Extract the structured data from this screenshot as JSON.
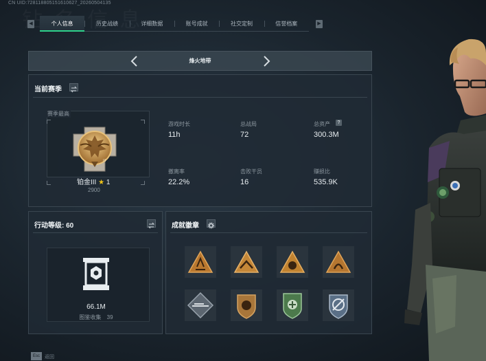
{
  "uid_line": "CN UID:728118805151610627_20260504135",
  "tabs": [
    {
      "label": "个人信息",
      "active": true
    },
    {
      "label": "历史战绩"
    },
    {
      "label": "详细数据"
    },
    {
      "label": "账号成就"
    },
    {
      "label": "社交定制"
    },
    {
      "label": "信誉档案"
    }
  ],
  "map_bar": {
    "title": "烽火地带"
  },
  "season": {
    "title": "当前赛季",
    "highest_label": "赛季最高",
    "rank_name": "铂金III",
    "rank_stars": "1",
    "rank_points": "2900",
    "stats": [
      {
        "label": "游戏时长",
        "value": "11h"
      },
      {
        "label": "总战局",
        "value": "72"
      },
      {
        "label": "总资产",
        "value": "300.3M"
      },
      {
        "label": "撤离率",
        "value": "22.2%"
      },
      {
        "label": "击败干员",
        "value": "16"
      },
      {
        "label": "赚损比",
        "value": "535.9K"
      }
    ]
  },
  "action_level": {
    "label": "行动等级:",
    "value": "60",
    "amount": "66.1M",
    "collection_label": "图鉴收集",
    "collection_value": "39"
  },
  "achievements": {
    "title": "成就徽章"
  },
  "footer": {
    "key": "Esc",
    "label": "返回"
  },
  "colors": {
    "accent": "#2fd38c",
    "star": "#f0c419",
    "gold": "#c9944a"
  }
}
